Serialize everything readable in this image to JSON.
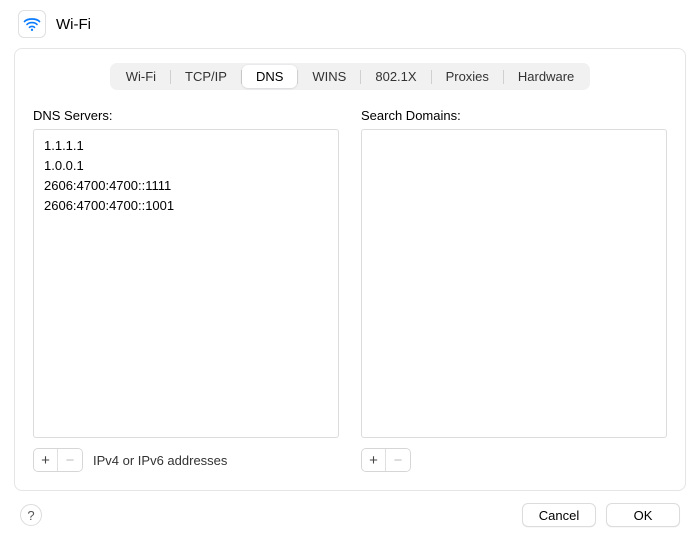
{
  "title": "Wi-Fi",
  "tabs": {
    "wifi": "Wi-Fi",
    "tcpip": "TCP/IP",
    "dns": "DNS",
    "wins": "WINS",
    "8021x": "802.1X",
    "proxies": "Proxies",
    "hardware": "Hardware"
  },
  "active_tab": "dns",
  "dns": {
    "label": "DNS Servers:",
    "servers": [
      "1.1.1.1",
      "1.0.0.1",
      "2606:4700:4700::1111",
      "2606:4700:4700::1001"
    ],
    "hint": "IPv4 or IPv6 addresses"
  },
  "search_domains": {
    "label": "Search Domains:",
    "domains": []
  },
  "buttons": {
    "add": "+",
    "remove": "−",
    "help": "?",
    "cancel": "Cancel",
    "ok": "OK"
  }
}
